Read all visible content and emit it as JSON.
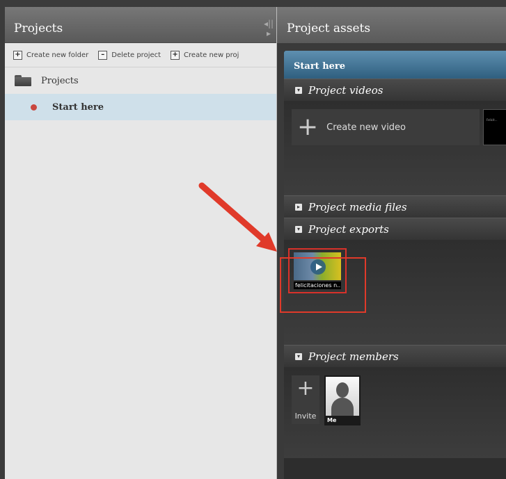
{
  "left_panel": {
    "title": "Projects",
    "toolbar": {
      "create_folder": "Create new folder",
      "delete_project": "Delete project",
      "create_project": "Create new proj"
    },
    "tree": {
      "root_label": "Projects",
      "selected_label": "Start here"
    }
  },
  "splitter_glyph": "◂||▸",
  "right_panel": {
    "title": "Project assets",
    "assets_title": "Start here",
    "sections": {
      "videos": "Project videos",
      "media": "Project media files",
      "exports": "Project exports",
      "members": "Project members"
    },
    "videos": {
      "create_label": "Create new video",
      "thumb_text": "Felicit..."
    },
    "exports": {
      "item_label": "felicitaciones n..."
    },
    "members": {
      "invite_label": "Invite",
      "member_name": "Me"
    }
  },
  "colors": {
    "selected_row": "#cfe0ea",
    "header_blue": "#3f7090",
    "annotation_red": "#e03a2a"
  },
  "icons": [
    "folder-icon",
    "status-dot-icon",
    "plus-icon",
    "play-icon",
    "avatar-icon",
    "chevron-down-icon",
    "chevron-right-icon"
  ]
}
